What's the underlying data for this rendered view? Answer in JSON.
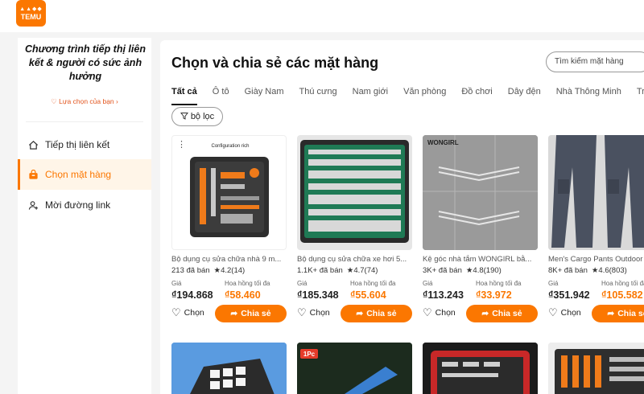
{
  "brand": {
    "logo_top": "▲▲◆◆",
    "logo_text": "TEMU",
    "accent": "#fb7701"
  },
  "sidebar": {
    "promo_title": "Chương trình tiếp thị liên kết & người có sức ảnh hưởng",
    "promo_sub": "Lựa chọn của bạn",
    "items": [
      {
        "label": "Tiếp thị liên kết",
        "icon": "home-icon"
      },
      {
        "label": "Chọn mặt hàng",
        "icon": "bag-icon",
        "active": true
      },
      {
        "label": "Mời đường link",
        "icon": "add-user-icon"
      }
    ]
  },
  "main": {
    "title": "Chọn và chia sẻ các mặt hàng",
    "search_placeholder": "Tìm kiếm mặt hàng",
    "tabs": [
      "Tất cả",
      "Ô tô",
      "Giày Nam",
      "Thú cưng",
      "Nam giới",
      "Văn phòng",
      "Đồ chơi",
      "Dây đện",
      "Nhà Thông Minh",
      "Trẻ"
    ],
    "filter_label": "bộ lọc",
    "price_label": "Giá",
    "commission_label": "Hoa hồng tối đa",
    "save_label": "Chọn",
    "share_label": "Chia sẻ",
    "products": [
      {
        "title": "Bộ dụng cụ sửa chữa nhà 9 m...",
        "sold": "213 đã bán",
        "rating": "4.2",
        "reviews": "(14)",
        "price": "₫194.868",
        "commission": "₫58.460",
        "thumb_text": "Configuration rich"
      },
      {
        "title": "Bộ dụng cụ sửa chữa xe hơi 5...",
        "sold": "1.1K+ đã bán",
        "rating": "4.7",
        "reviews": "(74)",
        "price": "₫185.348",
        "commission": "₫55.604"
      },
      {
        "title": "Kệ góc nhà tắm WONGIRL bằ...",
        "sold": "3K+ đã bán",
        "rating": "4.8",
        "reviews": "(190)",
        "price": "₫113.243",
        "commission": "₫33.972",
        "thumb_text": "WONGIRL"
      },
      {
        "title": "Men's Cargo Pants Outdoor",
        "sold": "8K+ đã bán",
        "rating": "4.6",
        "reviews": "(803)",
        "price": "₫351.942",
        "commission": "₫105.582"
      }
    ],
    "row2_badge": "1Pc"
  }
}
